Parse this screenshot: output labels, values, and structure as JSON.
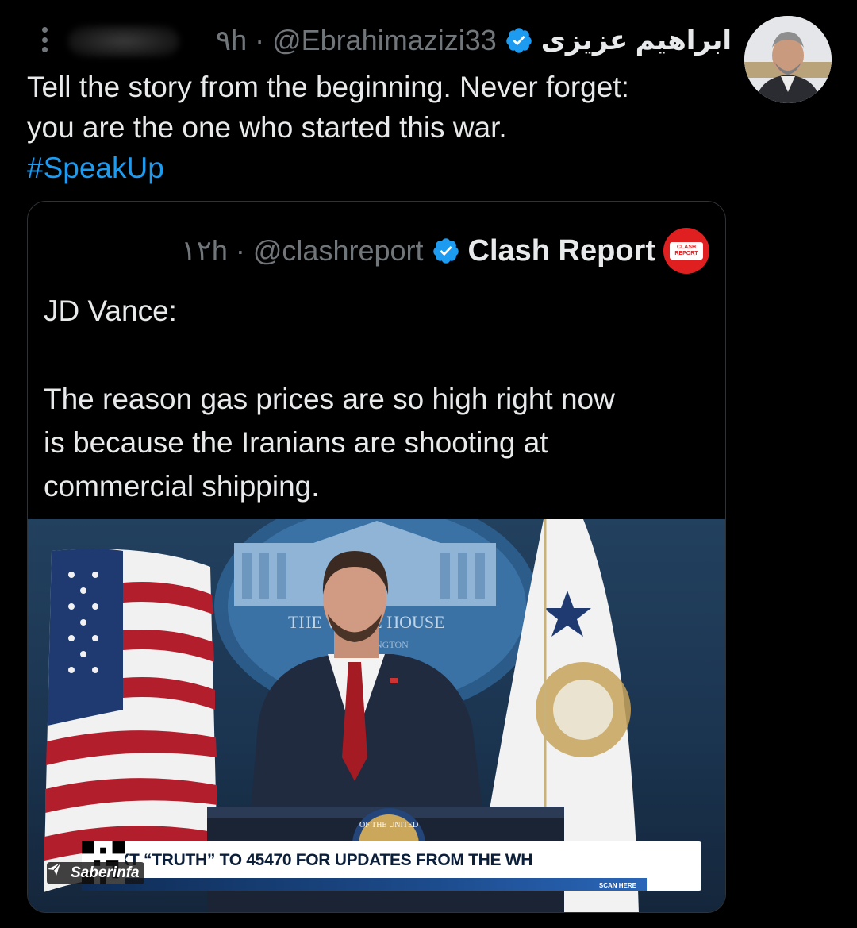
{
  "tweet": {
    "display_name": "ابراهیم عزیزی",
    "handle": "@Ebrahimazizi33",
    "time": "۹h",
    "separator": "·",
    "text_lines": [
      "Tell the story from the beginning. Never forget:",
      "you are the one who started this war."
    ],
    "hashtag": "#SpeakUp"
  },
  "quoted": {
    "display_name": "Clash Report",
    "handle": "@clashreport",
    "time": "۱۲h",
    "separator": "·",
    "logo_text": [
      "CLASH",
      "REPORT"
    ],
    "text_title": "JD Vance:",
    "text_lines": [
      "The reason gas prices are so high right now",
      "is because the Iranians are shooting at",
      "commercial shipping."
    ],
    "media": {
      "backdrop_sign": "THE WHITE HOUSE",
      "backdrop_sub": "WASHINGTON",
      "podium_seal": "OF THE UNITED",
      "ticker_text": "TEXT “TRUTH” TO 45470 FOR UPDATES FROM THE WH",
      "scan_here": "SCAN HERE",
      "watermark": "Saberinfa"
    }
  },
  "colors": {
    "background": "#000000",
    "text": "#e7e9ea",
    "muted": "#71767b",
    "link": "#1d9bf0",
    "verified": "#1d9bf0",
    "clash_red": "#e02020"
  },
  "icons": [
    "more-options-icon",
    "verified-badge-icon",
    "clash-report-logo",
    "avatar"
  ]
}
